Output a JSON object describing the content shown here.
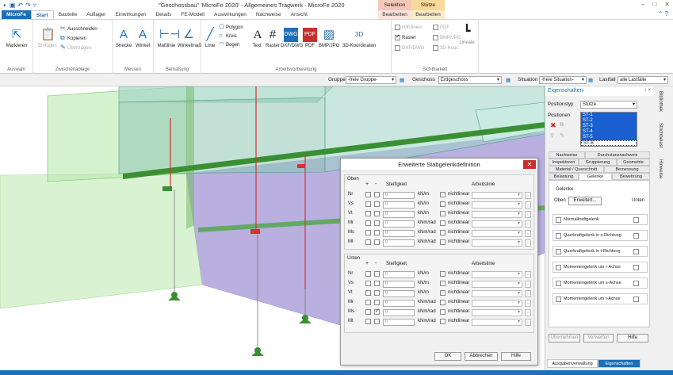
{
  "titlebar": {
    "title": "\"Geschossbau\" 'MicroFe 2020' - Allgemeines Tragwerk - MicroFe 2020",
    "ctx_selektion": "Selektion",
    "ctx_stuetze": "Stütze",
    "ctx_bearbeiten1": "Bearbeiten",
    "ctx_bearbeiten2": "Bearbeiten"
  },
  "tabs": [
    "MicroFe",
    "Start",
    "Bauteile",
    "Auflager",
    "Einwirkungen",
    "Details",
    "FE-Modell",
    "Auswirkungen",
    "Nachweise",
    "Ansicht"
  ],
  "ribbon": {
    "auswahl": {
      "markieren": "Markieren",
      "label": "Auswahl"
    },
    "zwischenablage": {
      "einfuegen": "Einfügen",
      "ausschneiden": "Ausschneiden",
      "kopieren": "Kopieren",
      "uebertragen": "Übertragen",
      "label": "Zwischenablage"
    },
    "messen": {
      "strecke": "Strecke",
      "winkel": "Winkel",
      "label": "Messen"
    },
    "bemassung": {
      "masslinie": "Maßlinie",
      "winkelmass": "Winkelmaß",
      "label": "Bemaßung"
    },
    "arbeitsvorbereitung": {
      "linie": "Linie",
      "polygon": "Polygon",
      "kreis": "Kreis",
      "bogen": "Bogen",
      "text": "Text",
      "raster": "Raster",
      "dxf": "DXF/DWG",
      "pdf": "PDF",
      "bmp": "BMP/JPG",
      "koord": "3D-Koordinaten",
      "label": "Arbeitsvorbereitung"
    },
    "sichtbarkeit": {
      "hilfslinien": "Hilfslinien",
      "pdf": "PDF",
      "raster": "Raster",
      "bmpjpg": "BMP/JPG",
      "dxfdwg": "DXF/DWG",
      "koord": "3D-Koor.",
      "lineale": "Lineale",
      "label": "Sichtbarkeit"
    }
  },
  "selection": {
    "gruppe_label": "Gruppe",
    "gruppe_value": "-freie Gruppe-",
    "geschoss_label": "Geschoss",
    "geschoss_value": "Erdgeschoss",
    "situation_label": "Situation",
    "situation_value": "-freie Situation-",
    "lastfall_label": "Lastfall",
    "lastfall_value": "alle Lastfälle"
  },
  "dialog": {
    "title": "Erweiterte Stabgelenkdefinition",
    "oben": "Oben",
    "unten": "Unten",
    "plus": "+",
    "minus": "-",
    "steifigkeit": "Steifigkeit",
    "arbeitslinie": "Arbeitslinie",
    "nichtlinear": "nichtlinear",
    "rows_top": [
      {
        "label": "Nr",
        "value": "0",
        "unit": "kN/m"
      },
      {
        "label": "Vs",
        "value": "0",
        "unit": "kN/m"
      },
      {
        "label": "Vt",
        "value": "0",
        "unit": "kN/m"
      },
      {
        "label": "Mr",
        "value": "0",
        "unit": "kNm/rad"
      },
      {
        "label": "Ms",
        "value": "0",
        "unit": "kNm/rad"
      },
      {
        "label": "Mt",
        "value": "0",
        "unit": "kNm/rad"
      }
    ],
    "rows_bottom": [
      {
        "label": "Nr",
        "value": "0",
        "unit": "kN/m"
      },
      {
        "label": "Vs",
        "value": "0",
        "unit": "kN/m"
      },
      {
        "label": "Vt",
        "value": "0",
        "unit": "kN/m"
      },
      {
        "label": "Mr",
        "value": "0",
        "unit": "kNm/rad"
      },
      {
        "label": "Ms",
        "value": "0",
        "unit": "kNm/rad"
      },
      {
        "label": "Mt",
        "value": "0",
        "unit": "kNm/rad"
      }
    ],
    "ok": "OK",
    "abbrechen": "Abbrechen",
    "hilfe": "Hilfe"
  },
  "panel": {
    "title": "Eigenschaften",
    "pin": "↓ ×",
    "positionstyp_label": "Positionstyp",
    "positionstyp_value": "Stütze",
    "positionen_label": "Positionen",
    "positionen": [
      "ST-1",
      "ST-2",
      "ST-3",
      "ST-4",
      "ST-5",
      "ST-6"
    ],
    "tabs": [
      "Nachweise",
      "Durchstanznachweis",
      "Inspektoren",
      "Gruppierung",
      "Geometrie",
      "Material / Querschnitt",
      "Bemessung",
      "Belastung",
      "Gelenke",
      "Bewehrung"
    ],
    "gelenke": "Gelenke",
    "oben": "Oben",
    "erweitert": "Erweitert...",
    "unten": "Unten",
    "items": [
      "Normalkraftgelenk",
      "Querkraftgelenk in s-Richtung",
      "Querkraftgelenk in t-Richtung",
      "Momentengelenk um r-Achse",
      "Momentengelenk um s-Achse",
      "Momentengelenk um t-Achse"
    ],
    "uebernehmen": "Übernehmen",
    "verwerfen": "Verwerfen",
    "hilfe": "Hilfe",
    "bottom_tab1": "Ausgabenverwaltung",
    "bottom_tab2": "Eigenschaften"
  },
  "vtabs": [
    "Bibliothek",
    "Strichbelast",
    "Hinweise"
  ],
  "colors": {
    "accent": "#1c6fb8",
    "selektion": "#f4c7b8",
    "stuetze": "#f7d79a"
  }
}
